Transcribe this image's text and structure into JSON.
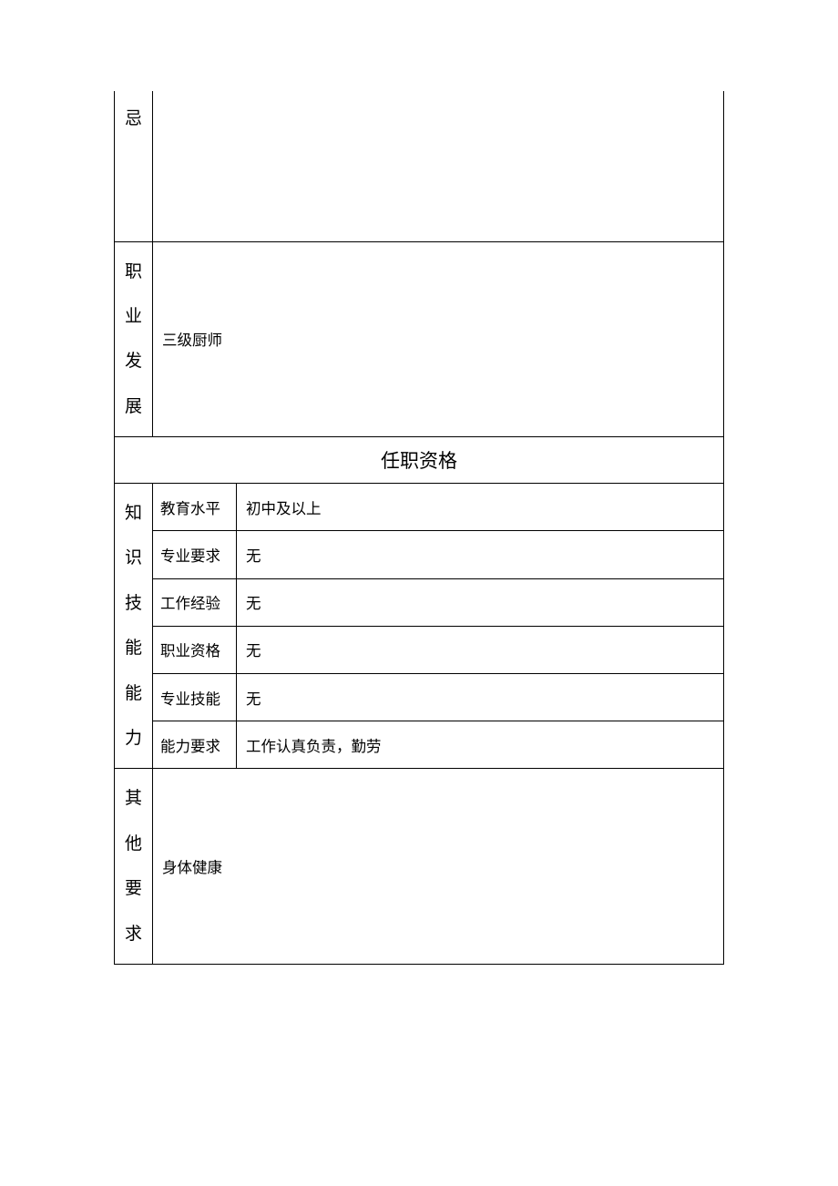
{
  "rows": {
    "r1_label": "忌",
    "r2_label_chars": [
      "职",
      "业",
      "发",
      "展"
    ],
    "r2_value": "三级厨师",
    "section_header": "任职资格",
    "vert_group_chars": [
      "知",
      "识",
      "技",
      "能",
      "能",
      "力"
    ],
    "qualifications": [
      {
        "label": "教育水平",
        "value": "初中及以上"
      },
      {
        "label": "专业要求",
        "value": "无"
      },
      {
        "label": "工作经验",
        "value": "无"
      },
      {
        "label": "职业资格",
        "value": "无"
      },
      {
        "label": "专业技能",
        "value": "无"
      },
      {
        "label": "能力要求",
        "value": "工作认真负责，勤劳"
      }
    ],
    "other_label_chars": [
      "其",
      "他",
      "要",
      "求"
    ],
    "other_value": "身体健康"
  }
}
